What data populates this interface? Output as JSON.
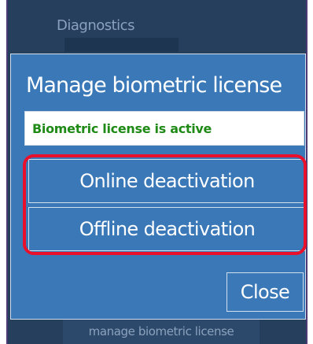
{
  "background": {
    "title": "Diagnostics",
    "footer_label": "manage biometric license"
  },
  "dialog": {
    "title": "Manage biometric license",
    "status_text": "Biometric license is active",
    "buttons": {
      "online": "Online deactivation",
      "offline": "Offline deactivation",
      "close": "Close"
    }
  },
  "colors": {
    "dialog_bg": "#3a78b7",
    "status_green": "#1f8a16",
    "highlight_red": "#e8102a",
    "backdrop": "#263f5c"
  }
}
